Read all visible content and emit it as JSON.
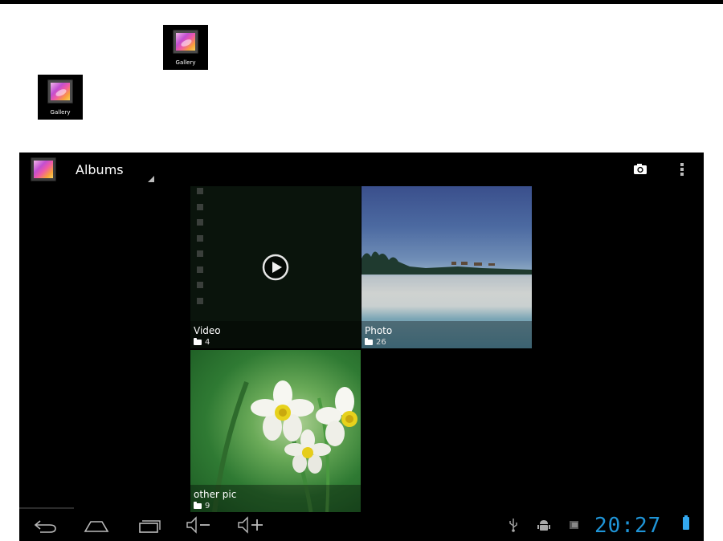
{
  "launcher_icons": [
    {
      "label": "Gallery"
    },
    {
      "label": "Gallery"
    }
  ],
  "action_bar": {
    "title": "Albums",
    "icons": [
      "gallery-app-icon",
      "spinner-caret-icon",
      "camera-icon",
      "overflow-menu-icon"
    ]
  },
  "albums": [
    {
      "name": "Video",
      "count": "4",
      "icon": "play-icon"
    },
    {
      "name": "Photo",
      "count": "26"
    },
    {
      "name": "other pic",
      "count": "9"
    }
  ],
  "nav_bar": {
    "icons": [
      "back-icon",
      "home-icon",
      "recent-apps-icon",
      "volume-down-icon",
      "volume-up-icon"
    ]
  },
  "status_bar": {
    "time": "20:27",
    "icons": [
      "usb-icon",
      "android-debug-icon",
      "notification-icon",
      "battery-icon"
    ]
  },
  "colors": {
    "clock": "#1f95d8",
    "battery": "#33a8ef",
    "screen_bg": "#000000"
  }
}
